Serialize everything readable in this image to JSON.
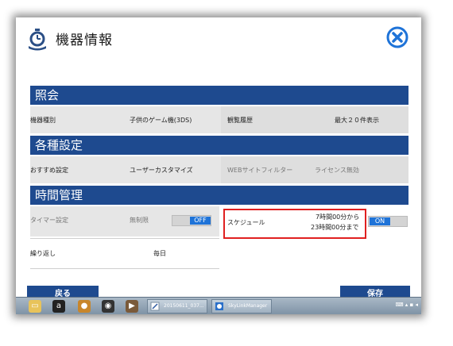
{
  "window": {
    "title": "機器情報"
  },
  "sections": {
    "inquiry": {
      "header": "照会",
      "device_type_label": "機器種別",
      "device_type_value": "子供のゲーム機(3DS)",
      "history_label": "観覧履歴",
      "history_value": "最大２０件表示"
    },
    "settings": {
      "header": "各種設定",
      "recommended_label": "おすすめ設定",
      "recommended_value": "ユーザーカスタマイズ",
      "web_filter_label": "WEBサイトフィルター",
      "web_filter_value": "ライセンス無効"
    },
    "time": {
      "header": "時間管理",
      "timer_label": "タイマー設定",
      "timer_value": "無制限",
      "timer_toggle": "OFF",
      "schedule_label": "スケジュール",
      "schedule_from": "7時間00分から",
      "schedule_to": "23時間00分まで",
      "schedule_toggle": "ON",
      "repeat_label": "繰り返し",
      "repeat_value": "毎日"
    }
  },
  "footer": {
    "back_label": "戻る",
    "save_label": "保存"
  },
  "taskbar": {
    "tasks": [
      "20150611_037...",
      "SkyLinkManager"
    ]
  },
  "colors": {
    "section_header": "#1e4a8f",
    "toggle_active": "#1e73d8",
    "highlight_border": "#e02020",
    "close_icon": "#1e73d8"
  }
}
